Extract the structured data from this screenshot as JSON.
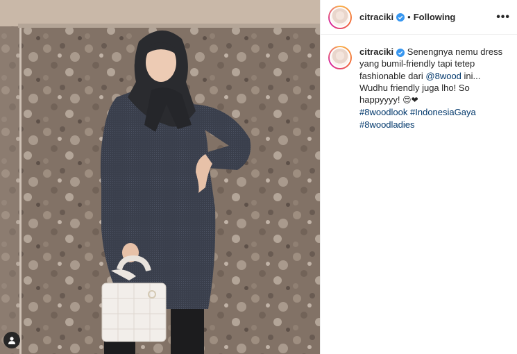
{
  "post": {
    "username": "citraciki",
    "follow_status": "Following",
    "dot": "•",
    "more": "•••"
  },
  "caption": {
    "username": "citraciki",
    "text_1": "Senengnya nemu dress yang bumil-friendly tapi tetep fashionable dari ",
    "mention": "@8wood",
    "text_2": " ini... Wudhu friendly juga lho! So happyyyy! ",
    "emojis": "😍❤",
    "hashtags": [
      "#8woodlook",
      "#IndonesiaGaya",
      "#8woodladies"
    ]
  },
  "icons": {
    "verified": "verified-badge-icon",
    "tag": "user-tag-icon",
    "more": "more-options-icon"
  },
  "colors": {
    "verified": "#3897f0",
    "link": "#00376b",
    "text": "#262626",
    "dress": "#3a3f4c",
    "stone_wall": "#8c7b6d"
  }
}
